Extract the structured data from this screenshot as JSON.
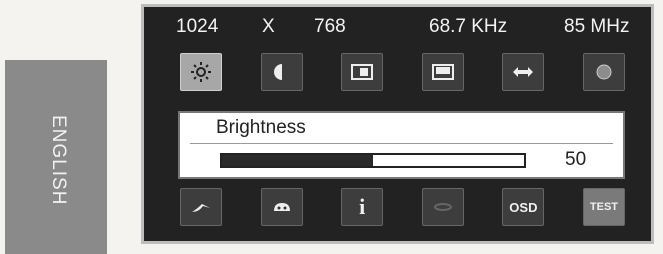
{
  "language_tab": {
    "label": "ENGLISH"
  },
  "status": {
    "width": "1024",
    "separator": "X",
    "height": "768",
    "h_freq": "68.7 KHz",
    "v_freq": "85 MHz"
  },
  "icons_top": [
    "brightness-icon",
    "contrast-icon",
    "h-position-icon",
    "v-position-icon",
    "h-size-icon",
    "color-icon"
  ],
  "icons_bottom": [
    "recall-icon",
    "geometry-icon",
    "info-icon",
    "advanced-icon",
    "osd-icon",
    "test-icon"
  ],
  "bottom_labels": {
    "osd": "OSD",
    "test": "TEST",
    "info": "i"
  },
  "adjustment": {
    "title": "Brightness",
    "value": "50",
    "level_fraction": 0.5
  }
}
